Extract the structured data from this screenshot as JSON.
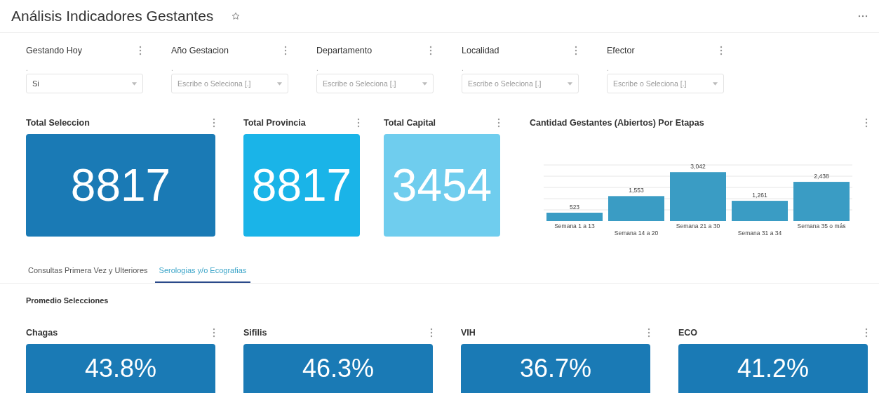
{
  "header": {
    "title": "Análisis Indicadores Gestantes",
    "favorite": false
  },
  "filters": [
    {
      "label": "Gestando Hoy",
      "hint": ".",
      "value": "Si"
    },
    {
      "label": "Año Gestacion",
      "hint": ".",
      "placeholder": "Escribe o Seleciona [.]"
    },
    {
      "label": "Departamento",
      "hint": ".",
      "placeholder": "Escribe o Seleciona [.]"
    },
    {
      "label": "Localidad",
      "hint": ".",
      "placeholder": "Escribe o Seleciona [.]"
    },
    {
      "label": "Efector",
      "hint": ".",
      "placeholder": "Escribe o Seleciona [.]"
    }
  ],
  "kpis": [
    {
      "title": "Total Seleccion",
      "value": "8817",
      "color": "#1a7ab5"
    },
    {
      "title": "Total Provincia",
      "value": "8817",
      "color": "#1ab4e8"
    },
    {
      "title": "Total Capital",
      "value": "3454",
      "color": "#6fcdee"
    }
  ],
  "chart": {
    "title": "Cantidad Gestantes (Abiertos) Por Etapas",
    "chart_data": {
      "type": "bar",
      "categories": [
        "Semana 1 a 13",
        "Semana 14 a 20",
        "Semana 21 a 30",
        "Semana 31 a 34",
        "Semana 35 o más"
      ],
      "values": [
        523,
        1553,
        3042,
        1261,
        2438
      ],
      "data_labels": true,
      "value_labels": [
        "523",
        "1,553",
        "3,042",
        "1,261",
        "2,438"
      ]
    }
  },
  "tabs": [
    {
      "label": "Consultas Primera Vez y Ulteriores",
      "selected": false
    },
    {
      "label": "Serologias y/o Ecografias",
      "selected": true
    }
  ],
  "section_title": "Promedio Selecciones",
  "indicators": [
    {
      "title": "Chagas",
      "value": "43.8%"
    },
    {
      "title": "Sifilis",
      "value": "46.3%"
    },
    {
      "title": "VIH",
      "value": "36.7%"
    },
    {
      "title": "ECO",
      "value": "41.2%"
    }
  ]
}
